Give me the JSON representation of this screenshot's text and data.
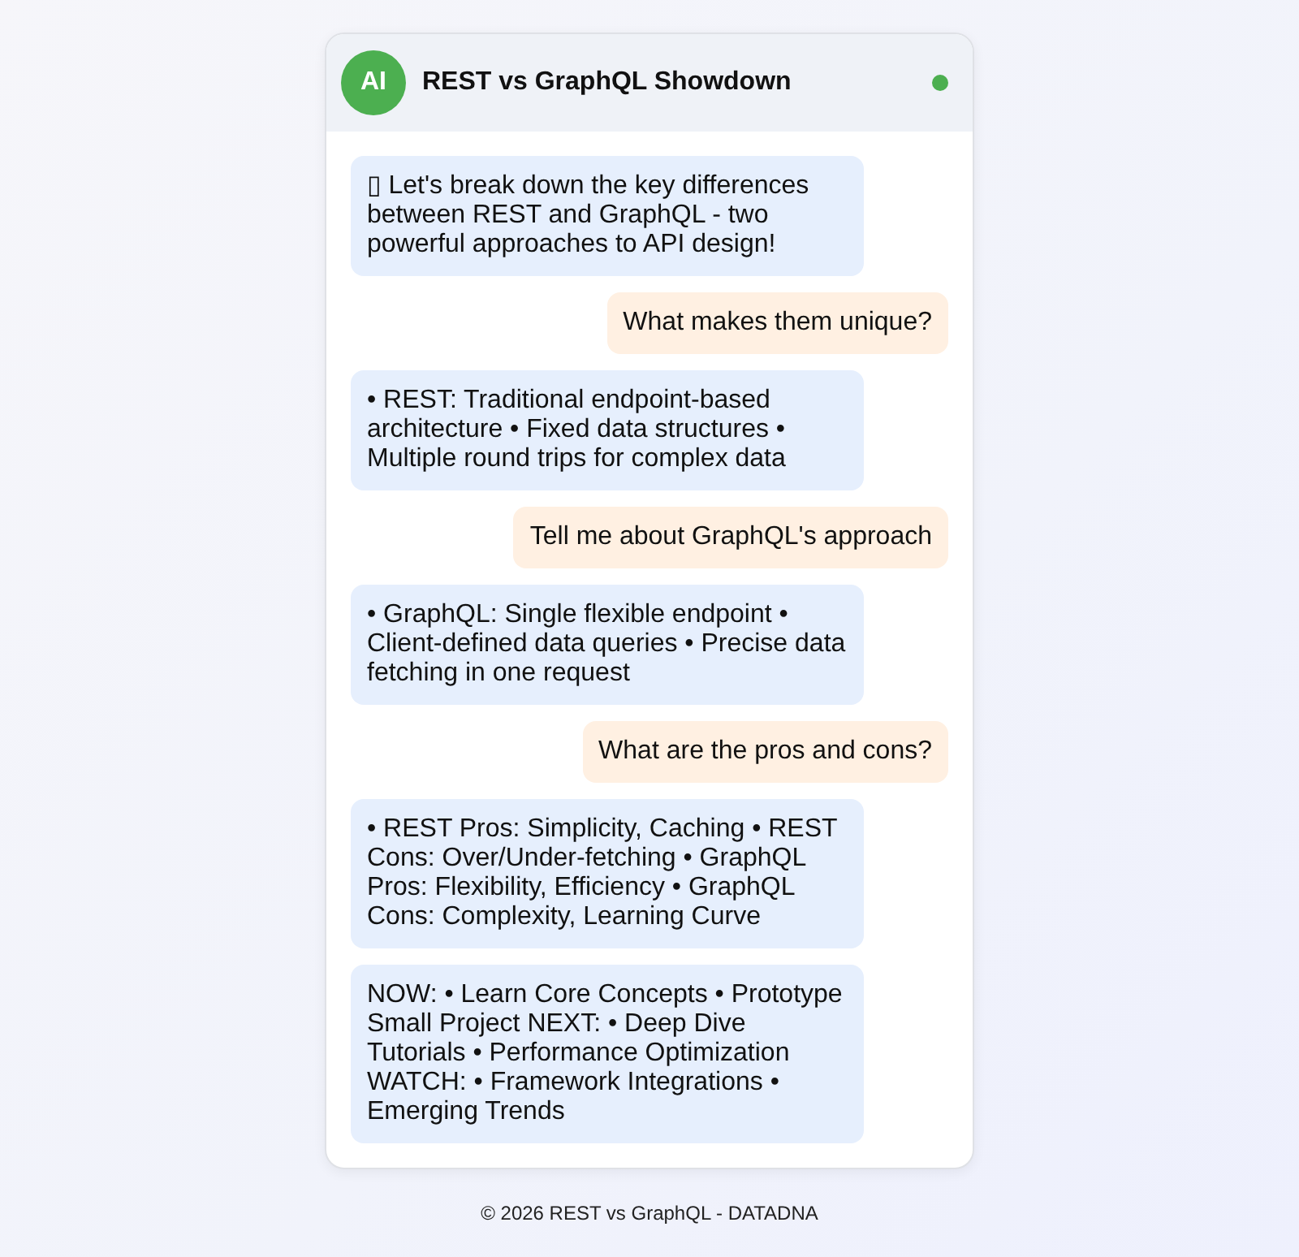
{
  "header": {
    "avatar": "AI",
    "title": "REST vs GraphQL Showdown",
    "online": true
  },
  "messages": [
    {
      "kind": "bot",
      "text": "▯ Let's break down the key differences between REST and GraphQL - two powerful approaches to API design!"
    },
    {
      "kind": "user",
      "text": "What makes them unique?"
    },
    {
      "kind": "bot",
      "text": "• REST: Traditional endpoint-based architecture • Fixed data structures • Multiple round trips for complex data"
    },
    {
      "kind": "user",
      "text": "Tell me about GraphQL's approach"
    },
    {
      "kind": "bot",
      "text": "• GraphQL: Single flexible endpoint • Client-defined data queries • Precise data fetching in one request"
    },
    {
      "kind": "user",
      "text": "What are the pros and cons?"
    },
    {
      "kind": "bot",
      "text": "• REST Pros: Simplicity, Caching • REST Cons: Over/Under-fetching • GraphQL Pros: Flexibility, Efficiency • GraphQL Cons: Complexity, Learning Curve"
    },
    {
      "kind": "bot",
      "text": "NOW: • Learn Core Concepts • Prototype Small Project NEXT: • Deep Dive Tutorials • Performance Optimization WATCH: • Framework Integrations • Emerging Trends"
    }
  ],
  "footer": "© 2026 REST vs GraphQL - DATADNA"
}
